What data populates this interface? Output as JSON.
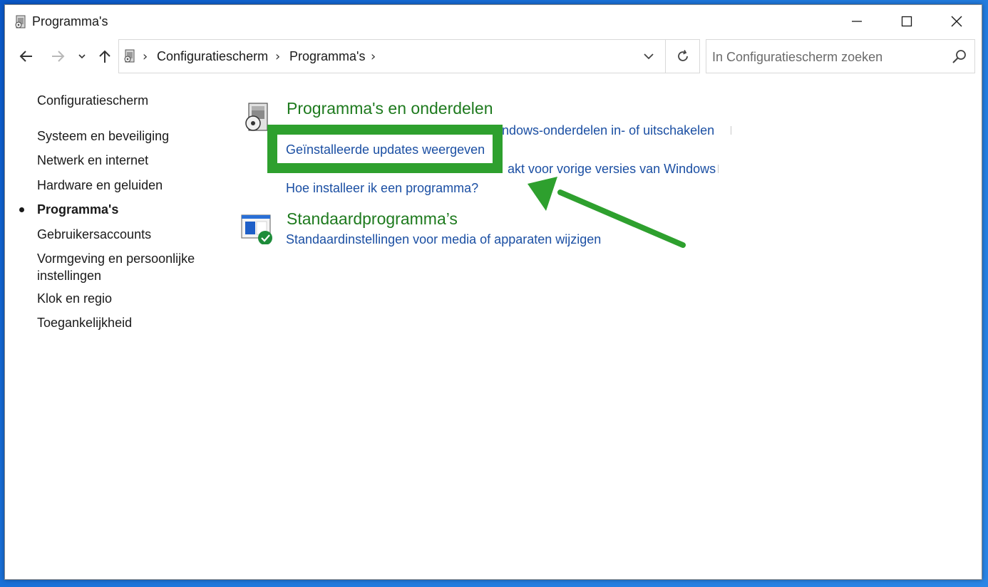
{
  "window": {
    "title": "Programma's"
  },
  "nav": {
    "back_icon": "arrow-left-icon",
    "forward_icon": "arrow-right-icon",
    "recent_icon": "chevron-down-icon",
    "up_icon": "arrow-up-icon"
  },
  "address": {
    "crumbs": [
      "Configuratiescherm",
      "Programma's"
    ]
  },
  "search": {
    "placeholder": "In Configuratiescherm zoeken"
  },
  "sidebar": {
    "home": "Configuratiescherm",
    "items": [
      {
        "label": "Systeem en beveiliging"
      },
      {
        "label": "Netwerk en internet"
      },
      {
        "label": "Hardware en geluiden"
      },
      {
        "label": "Programma's",
        "active": true
      },
      {
        "label": "Gebruikersaccounts"
      },
      {
        "label": "Vormgeving en persoonlijke instellingen"
      },
      {
        "label": "Klok en regio"
      },
      {
        "label": "Toegankelijkheid"
      }
    ]
  },
  "main": {
    "programs": {
      "title": "Programma's en onderdelen",
      "links": {
        "windows_features": "ndows-onderdelen in- of uitschakelen",
        "installed_updates": "Geïnstalleerde updates weergeven",
        "compat": "akt voor vorige versies van Windows",
        "how_install": "Hoe installeer ik een programma?"
      }
    },
    "defaults": {
      "title": "Standaardprogramma’s",
      "link": "Standaardinstellingen voor media of apparaten wijzigen"
    }
  },
  "annotation": {
    "color": "#2ea02e"
  }
}
